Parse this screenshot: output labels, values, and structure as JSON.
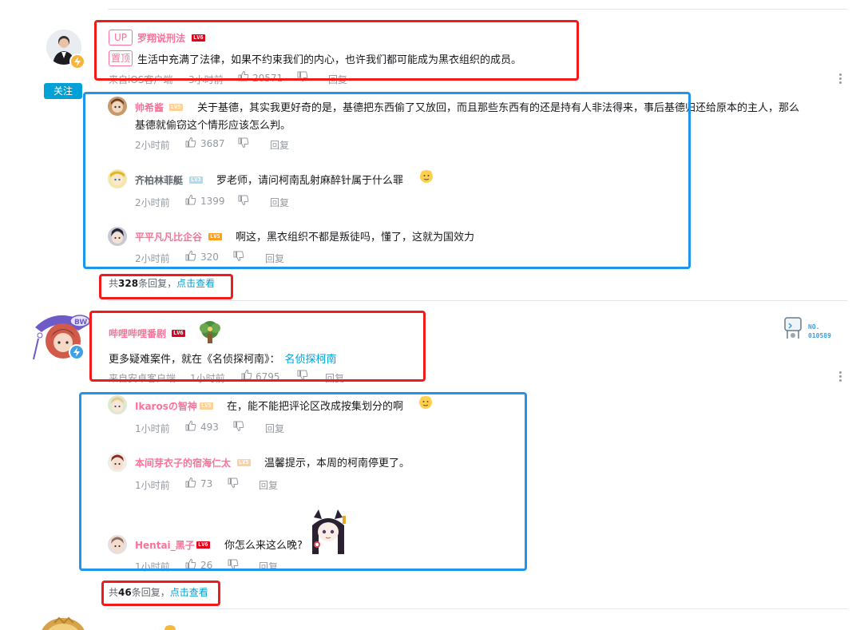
{
  "comments": [
    {
      "username": "罗翔说刑法",
      "level": "LV6",
      "up_badge": "UP",
      "pinned_badge": "置顶",
      "text": "生活中充满了法律，如果不约束我们的内心，也许我们都可能成为黑衣组织的成员。",
      "source": "来自iOS客户端",
      "time": "3小时前",
      "likes": "20571",
      "reply_label": "回复",
      "follow_label": "关注",
      "replies": [
        {
          "username": "帅希酱",
          "level": "LV5",
          "text_line1": "关于基德，其实我更好奇的是，基德把东西偷了又放回，而且那些东西有的还是持有人非法得来，事后基德归还给原本的主人，那么",
          "text_line2": "基德就偷窃这个情形应该怎么判。",
          "time": "2小时前",
          "likes": "3687",
          "reply_label": "回复"
        },
        {
          "username": "齐柏林菲艇",
          "level": "LV3",
          "text": "罗老师，请问柯南乱射麻醉针属于什么罪",
          "time": "2小时前",
          "likes": "1399",
          "reply_label": "回复"
        },
        {
          "username": "平平凡凡比企谷",
          "level": "LV5",
          "text": "啊这，黑衣组织不都是叛徒吗，懂了，这就为国效力",
          "time": "2小时前",
          "likes": "320",
          "reply_label": "回复"
        }
      ],
      "reply_summary_prefix": "共",
      "reply_summary_count": "328",
      "reply_summary_suffix": "条回复，",
      "view_link": "点击查看"
    },
    {
      "username": "哔哩哔哩番剧",
      "level": "LV6",
      "text_prefix": "更多疑难案件，就在《名侦探柯南》：",
      "text_link": "名侦探柯南",
      "source": "来自安卓客户端",
      "time": "1小时前",
      "likes": "6795",
      "reply_label": "回复",
      "fan_no_label": "NO.",
      "fan_no_value": "010589",
      "replies": [
        {
          "username": "Ikarosの智神",
          "level": "LV5",
          "text": "在，能不能把评论区改成按集划分的啊",
          "time": "1小时前",
          "likes": "493",
          "reply_label": "回复"
        },
        {
          "username": "本间芽衣子的宿海仁太",
          "level": "LV5",
          "text": "温馨提示，本周的柯南停更了。",
          "time": "1小时前",
          "likes": "73",
          "reply_label": "回复"
        },
        {
          "username": "Hentai_黑子",
          "level": "LV6",
          "text": "你怎么来这么晚?",
          "time": "1小时前",
          "likes": "26",
          "reply_label": "回复"
        }
      ],
      "reply_summary_prefix": "共",
      "reply_summary_count": "46",
      "reply_summary_suffix": "条回复，",
      "view_link": "点击查看"
    }
  ],
  "colors": {
    "pink": "#fb7299",
    "blue_link": "#00a1d6",
    "annotation_red": "#f01c1c",
    "annotation_blue": "#1e96f0",
    "meta_gray": "#9499a0"
  },
  "icons": [
    "thumbs-up-icon",
    "thumbs-down-icon",
    "more-dots-icon",
    "lightning-badge-icon",
    "level-badge-icon"
  ]
}
